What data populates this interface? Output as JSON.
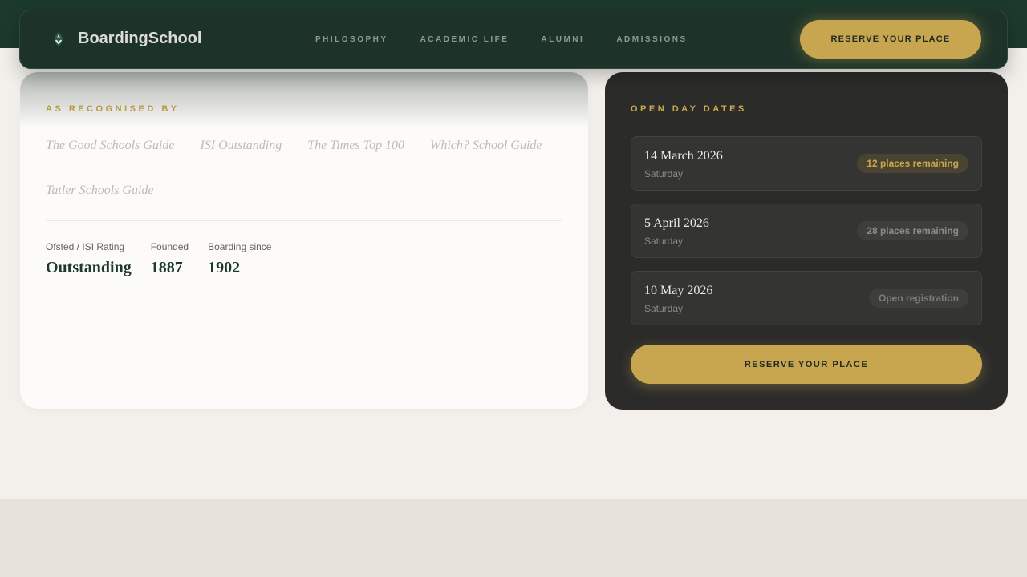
{
  "nav": {
    "brand": "BoardingSchool",
    "logo_icon": "crest-leaf-icon",
    "links": [
      "PHILOSOPHY",
      "ACADEMIC LIFE",
      "ALUMNI",
      "ADMISSIONS"
    ],
    "cta": "RESERVE YOUR PLACE"
  },
  "recognition": {
    "eyebrow": "AS RECOGNISED BY",
    "items": [
      "The Good Schools Guide",
      "ISI Outstanding",
      "The Times Top 100",
      "Which? School Guide",
      "Tatler Schools Guide"
    ]
  },
  "stats": [
    {
      "label": "Ofsted / ISI Rating",
      "value": "Outstanding"
    },
    {
      "label": "Founded",
      "value": "1887"
    },
    {
      "label": "Boarding since",
      "value": "1902"
    }
  ],
  "open_days": {
    "eyebrow": "OPEN DAY DATES",
    "dates": [
      {
        "date": "14 March 2026",
        "day": "Saturday",
        "status": "12 places remaining"
      },
      {
        "date": "5 April 2026",
        "day": "Saturday",
        "status": "28 places remaining"
      },
      {
        "date": "10 May 2026",
        "day": "Saturday",
        "status": "Open registration"
      }
    ],
    "cta": "RESERVE YOUR PLACE"
  },
  "colors": {
    "brand_green": "#1c3a2c",
    "accent_gold": "#c8a54f",
    "dark_panel": "#2b2b2a"
  }
}
